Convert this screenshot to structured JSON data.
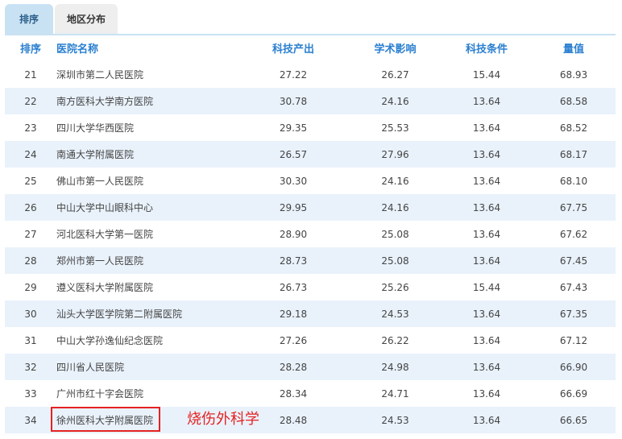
{
  "tabs": [
    {
      "label": "排序",
      "active": true
    },
    {
      "label": "地区分布",
      "active": false
    }
  ],
  "table": {
    "headers": {
      "rank": "排序",
      "name": "医院名称",
      "sci_output": "科技产出",
      "academic": "学术影响",
      "conditions": "科技条件",
      "value": "量值"
    },
    "rows": [
      {
        "rank": "21",
        "name": "深圳市第二人民医院",
        "sci_output": "27.22",
        "academic": "26.27",
        "conditions": "15.44",
        "value": "68.93"
      },
      {
        "rank": "22",
        "name": "南方医科大学南方医院",
        "sci_output": "30.78",
        "academic": "24.16",
        "conditions": "13.64",
        "value": "68.58"
      },
      {
        "rank": "23",
        "name": "四川大学华西医院",
        "sci_output": "29.35",
        "academic": "25.53",
        "conditions": "13.64",
        "value": "68.52"
      },
      {
        "rank": "24",
        "name": "南通大学附属医院",
        "sci_output": "26.57",
        "academic": "27.96",
        "conditions": "13.64",
        "value": "68.17"
      },
      {
        "rank": "25",
        "name": "佛山市第一人民医院",
        "sci_output": "30.30",
        "academic": "24.16",
        "conditions": "13.64",
        "value": "68.10"
      },
      {
        "rank": "26",
        "name": "中山大学中山眼科中心",
        "sci_output": "29.95",
        "academic": "24.16",
        "conditions": "13.64",
        "value": "67.75"
      },
      {
        "rank": "27",
        "name": "河北医科大学第一医院",
        "sci_output": "28.90",
        "academic": "25.08",
        "conditions": "13.64",
        "value": "67.62"
      },
      {
        "rank": "28",
        "name": "郑州市第一人民医院",
        "sci_output": "28.73",
        "academic": "25.08",
        "conditions": "13.64",
        "value": "67.45"
      },
      {
        "rank": "29",
        "name": "遵义医科大学附属医院",
        "sci_output": "26.73",
        "academic": "25.26",
        "conditions": "15.44",
        "value": "67.43"
      },
      {
        "rank": "30",
        "name": "汕头大学医学院第二附属医院",
        "sci_output": "29.18",
        "academic": "24.53",
        "conditions": "13.64",
        "value": "67.35"
      },
      {
        "rank": "31",
        "name": "中山大学孙逸仙纪念医院",
        "sci_output": "27.26",
        "academic": "26.22",
        "conditions": "13.64",
        "value": "67.12"
      },
      {
        "rank": "32",
        "name": "四川省人民医院",
        "sci_output": "28.28",
        "academic": "24.98",
        "conditions": "13.64",
        "value": "66.90"
      },
      {
        "rank": "33",
        "name": "广州市红十字会医院",
        "sci_output": "28.34",
        "academic": "24.71",
        "conditions": "13.64",
        "value": "66.69"
      },
      {
        "rank": "34",
        "name": "徐州医科大学附属医院",
        "sci_output": "28.48",
        "academic": "24.53",
        "conditions": "13.64",
        "value": "66.65"
      }
    ]
  },
  "annotation": {
    "text": "烧伤外科学",
    "color": "#e52222"
  },
  "colors": {
    "header_text": "#2a7fd0",
    "row_alt": "#e9f2fb",
    "tab_active": "#c9e2f3",
    "tab_inactive": "#eeeeee",
    "highlight": "#e52222"
  }
}
